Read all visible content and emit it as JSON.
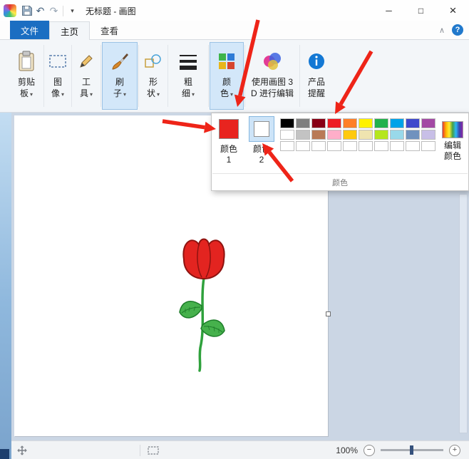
{
  "titlebar": {
    "title": "无标题 - 画图"
  },
  "icons": {
    "undo": "↶",
    "redo": "↷",
    "qat_dropdown": "▾",
    "dropdown": "▾",
    "minimize": "─",
    "maximize": "□",
    "close": "×",
    "ribbon_collapse": "∧",
    "help": "?",
    "zoom_out": "−",
    "zoom_in": "+"
  },
  "tabs": {
    "file": "文件",
    "home": "主页",
    "view": "查看"
  },
  "ribbon": {
    "clipboard": {
      "line1": "剪贴",
      "line2": "板"
    },
    "image": {
      "line1": "图",
      "line2": "像"
    },
    "tools": {
      "line1": "工",
      "line2": "具"
    },
    "brushes": {
      "line1": "刷",
      "line2": "子"
    },
    "shapes": {
      "line1": "形",
      "line2": "状"
    },
    "size": {
      "line1": "粗",
      "line2": "细"
    },
    "colors": {
      "line1": "颜",
      "line2": "色"
    },
    "paint3d": {
      "line1": "使用画图 3",
      "line2": "D 进行编辑"
    },
    "alerts": {
      "line1": "产品",
      "line2": "提醒"
    }
  },
  "color_panel": {
    "color1": {
      "label1": "颜色",
      "label2": "1",
      "value": "#e8241f"
    },
    "color2": {
      "label1": "颜色",
      "label2": "2",
      "value": "#ffffff"
    },
    "edit_colors": {
      "label1": "编辑",
      "label2": "颜色"
    },
    "caption": "颜色",
    "palette": [
      [
        "#000000",
        "#7f7f7f",
        "#880015",
        "#ed1c24",
        "#ff7f27",
        "#fff200",
        "#22b14c",
        "#00a2e8",
        "#3f48cc",
        "#a349a4"
      ],
      [
        "#ffffff",
        "#c3c3c3",
        "#b97a57",
        "#ffaec9",
        "#ffc90e",
        "#efe4b0",
        "#b5e61d",
        "#99d9ea",
        "#7092be",
        "#c8bfe7"
      ],
      [
        "#ffffff",
        "#ffffff",
        "#ffffff",
        "#ffffff",
        "#ffffff",
        "#ffffff",
        "#ffffff",
        "#ffffff",
        "#ffffff",
        "#ffffff"
      ]
    ]
  },
  "statusbar": {
    "zoom_level": "100%"
  },
  "canvas_drawing": {
    "subject": "red tulip flower with green stem and two leaves",
    "petal_color": "#e32420",
    "petal_outline": "#8e1310",
    "stem_color": "#2fa13c",
    "leaf_color": "#46b14c",
    "leaf_outline": "#1e7d2a"
  },
  "accents": {
    "annotation_arrow": "#ee2418",
    "selection_highlight": "#cde4f8",
    "file_tab": "#1b6ec2"
  }
}
